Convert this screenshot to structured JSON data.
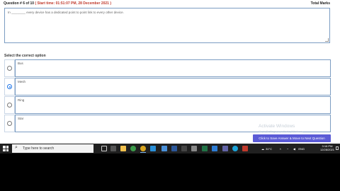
{
  "header": {
    "question_number": "Question # 6 of 10",
    "start_time": "( Start time: 01:51:07 PM, 28 December 2021 )",
    "total_marks": "Total Marks"
  },
  "question": {
    "text": "In ________ every device has a dedicated point to point link to every other device."
  },
  "options_label": "Select the correct option",
  "options": [
    {
      "label": "Bus",
      "selected": false
    },
    {
      "label": "Mesh",
      "selected": true
    },
    {
      "label": "Ring",
      "selected": false
    },
    {
      "label": "Star",
      "selected": false
    }
  ],
  "watermark": {
    "title": "Activate Windows",
    "subtitle": "Go to Settings to activate Windows."
  },
  "next_button": "Click to Save Answer & Move to Next Question",
  "taskbar": {
    "search_placeholder": "Type here to search",
    "icons": [
      "task-view-icon",
      "file-explorer-icon",
      "chrome-icon",
      "store-icon",
      "mail-icon",
      "word-icon",
      "excel-icon",
      "photoshop-icon",
      "teams-icon",
      "edge-icon",
      "app-icon"
    ],
    "weather": "31°C",
    "language": "ENG",
    "time": "3:16 PM",
    "date": "12/28/2021"
  }
}
